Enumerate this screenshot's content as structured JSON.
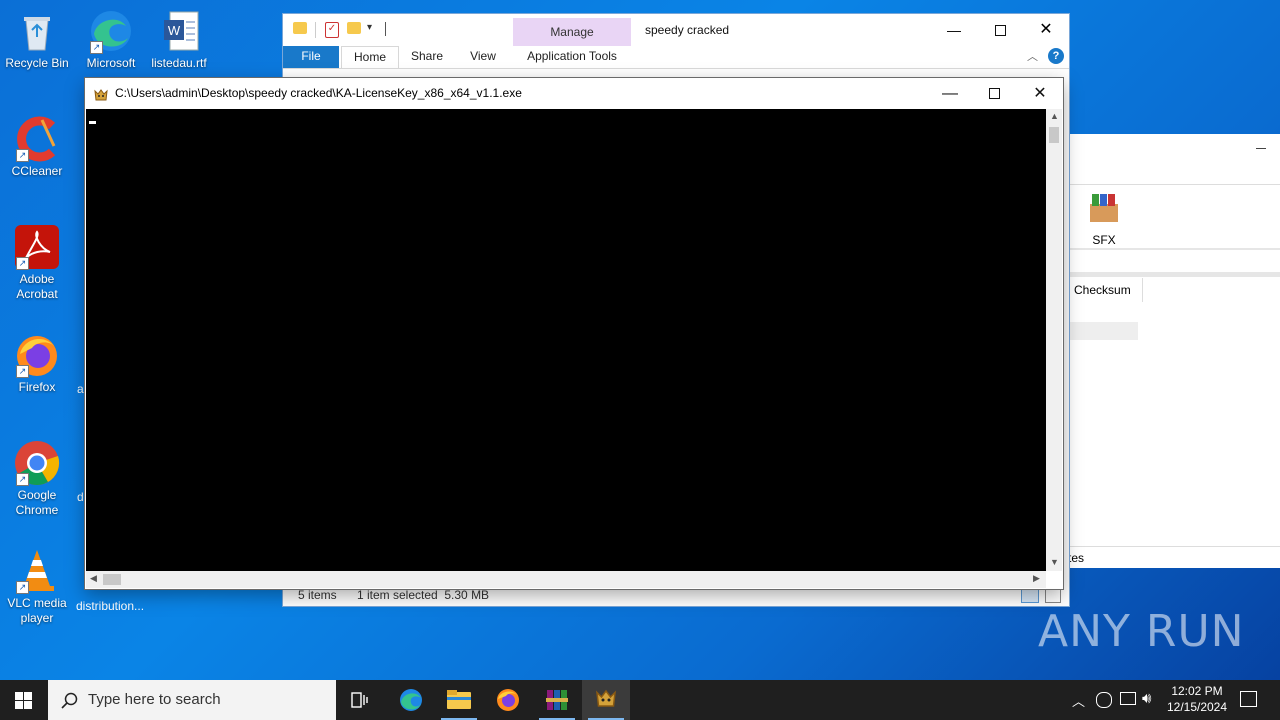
{
  "desktop": {
    "icons": [
      {
        "label": "Recycle Bin"
      },
      {
        "label": "Microsoft Edge"
      },
      {
        "label": "listedau.rtf"
      },
      {
        "label": "CCleaner"
      },
      {
        "label": "Adobe Acrobat"
      },
      {
        "label": "Firefox"
      },
      {
        "label": "Google Chrome"
      },
      {
        "label": "VLC media player"
      },
      {
        "label": "distribution..."
      },
      {
        "label": "a"
      },
      {
        "label": "d"
      }
    ]
  },
  "explorer": {
    "title": "speedy cracked",
    "manage_tab": "Manage",
    "tabs": [
      "File",
      "Home",
      "Share",
      "View",
      "Application Tools"
    ],
    "status": {
      "items": "5 items",
      "selected": "1 item selected  5.30 MB"
    }
  },
  "winrar": {
    "sfx_label": "SFX",
    "column": "Checksum",
    "partial": "tes"
  },
  "console": {
    "title": "C:\\Users\\admin\\Desktop\\speedy cracked\\KA-LicenseKey_x86_x64_v1.1.exe"
  },
  "taskbar": {
    "search_placeholder": "Type here to search",
    "time": "12:02 PM",
    "date": "12/15/2024"
  },
  "watermark": "ANY RUN"
}
